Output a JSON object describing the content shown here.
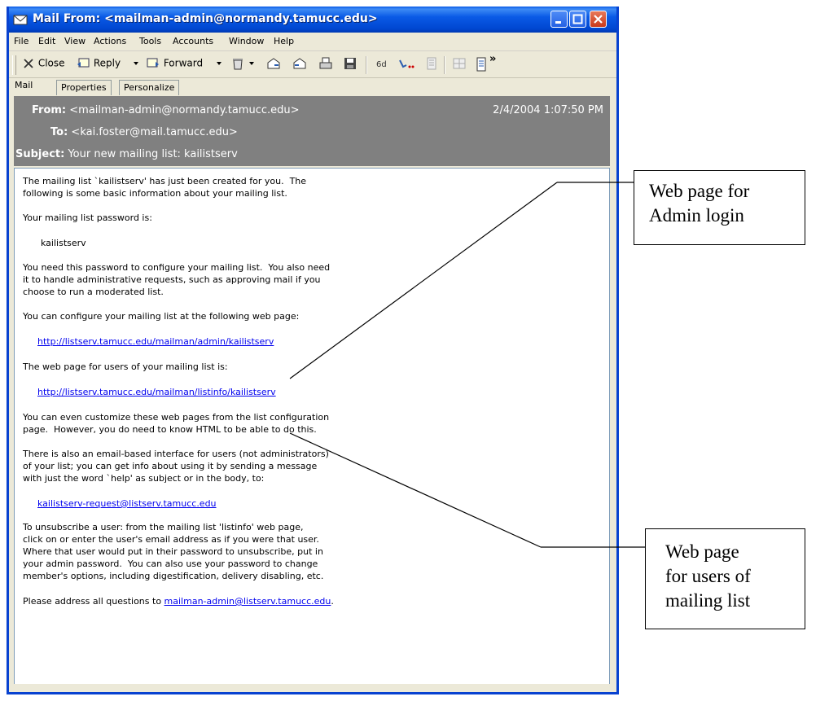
{
  "window": {
    "title": "Mail From: <mailman-admin@normandy.tamucc.edu>"
  },
  "menu": [
    "File",
    "Edit",
    "View",
    "Actions",
    "Tools",
    "Accounts",
    "Window",
    "Help"
  ],
  "toolbar": {
    "close_label": "Close",
    "reply_label": "Reply",
    "forward_label": "Forward",
    "overflow_label": "»"
  },
  "tabs": [
    "Mail",
    "Properties",
    "Personalize"
  ],
  "header": {
    "from_label": "From:",
    "from_value": "<mailman-admin@normandy.tamucc.edu>",
    "date": "2/4/2004 1:07:50 PM",
    "to_label": "To:",
    "to_value": "<kai.foster@mail.tamucc.edu>",
    "subject_label": "Subject:",
    "subject_value": "Your new mailing list: kailistserv"
  },
  "body": {
    "p1": "The mailing list `kailistserv' has just been created for you.  The\nfollowing is some basic information about your mailing list.",
    "p2": "Your mailing list password is:",
    "password": "kailistserv",
    "p3": "You need this password to configure your mailing list.  You also need\nit to handle administrative requests, such as approving mail if you\nchoose to run a moderated list.",
    "p4": "You can configure your mailing list at the following web page:",
    "admin_link": "http://listserv.tamucc.edu/mailman/admin/kailistserv",
    "p5": "The web page for users of your mailing list is:",
    "users_link": "http://listserv.tamucc.edu/mailman/listinfo/kailistserv",
    "p6": "You can even customize these web pages from the list configuration\npage.  However, you do need to know HTML to be able to do this.",
    "p7": "There is also an email-based interface for users (not administrators)\nof your list; you can get info about using it by sending a message\nwith just the word `help' as subject or in the body, to:",
    "request_link": "kailistserv-request@listserv.tamucc.edu",
    "p8": "To unsubscribe a user: from the mailing list 'listinfo' web page,\nclick on or enter the user's email address as if you were that user.\nWhere that user would put in their password to unsubscribe, put in\nyour admin password.  You can also use your password to change\nmember's options, including digestification, delivery disabling, etc.",
    "p9_prefix": "Please address all questions to ",
    "p9_link": "mailman-admin@listserv.tamucc.edu",
    "p9_suffix": "."
  },
  "callouts": {
    "admin": [
      "Web page for",
      "Admin login"
    ],
    "users": [
      "Web page",
      "for users of",
      "mailing list"
    ]
  }
}
